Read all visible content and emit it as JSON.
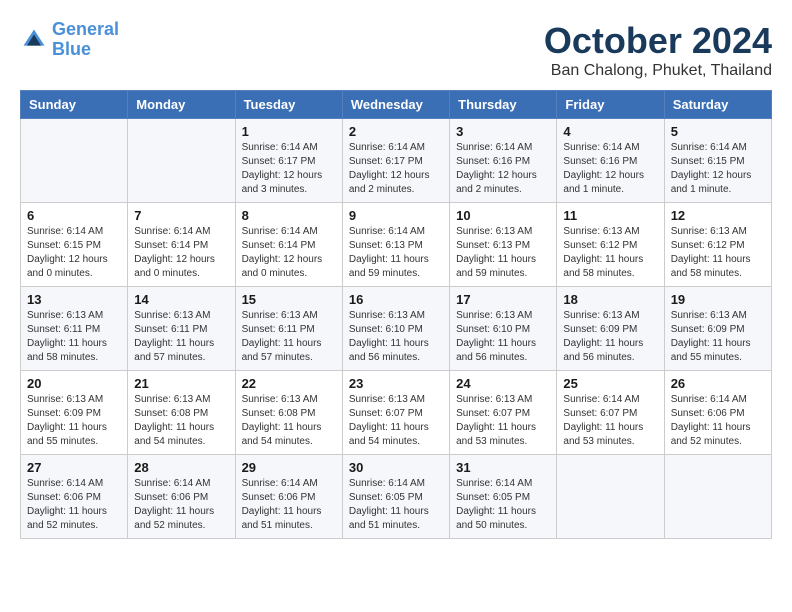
{
  "logo": {
    "line1": "General",
    "line2": "Blue"
  },
  "title": "October 2024",
  "location": "Ban Chalong, Phuket, Thailand",
  "headers": [
    "Sunday",
    "Monday",
    "Tuesday",
    "Wednesday",
    "Thursday",
    "Friday",
    "Saturday"
  ],
  "weeks": [
    [
      {
        "day": "",
        "info": ""
      },
      {
        "day": "",
        "info": ""
      },
      {
        "day": "1",
        "info": "Sunrise: 6:14 AM\nSunset: 6:17 PM\nDaylight: 12 hours\nand 3 minutes."
      },
      {
        "day": "2",
        "info": "Sunrise: 6:14 AM\nSunset: 6:17 PM\nDaylight: 12 hours\nand 2 minutes."
      },
      {
        "day": "3",
        "info": "Sunrise: 6:14 AM\nSunset: 6:16 PM\nDaylight: 12 hours\nand 2 minutes."
      },
      {
        "day": "4",
        "info": "Sunrise: 6:14 AM\nSunset: 6:16 PM\nDaylight: 12 hours\nand 1 minute."
      },
      {
        "day": "5",
        "info": "Sunrise: 6:14 AM\nSunset: 6:15 PM\nDaylight: 12 hours\nand 1 minute."
      }
    ],
    [
      {
        "day": "6",
        "info": "Sunrise: 6:14 AM\nSunset: 6:15 PM\nDaylight: 12 hours\nand 0 minutes."
      },
      {
        "day": "7",
        "info": "Sunrise: 6:14 AM\nSunset: 6:14 PM\nDaylight: 12 hours\nand 0 minutes."
      },
      {
        "day": "8",
        "info": "Sunrise: 6:14 AM\nSunset: 6:14 PM\nDaylight: 12 hours\nand 0 minutes."
      },
      {
        "day": "9",
        "info": "Sunrise: 6:14 AM\nSunset: 6:13 PM\nDaylight: 11 hours\nand 59 minutes."
      },
      {
        "day": "10",
        "info": "Sunrise: 6:13 AM\nSunset: 6:13 PM\nDaylight: 11 hours\nand 59 minutes."
      },
      {
        "day": "11",
        "info": "Sunrise: 6:13 AM\nSunset: 6:12 PM\nDaylight: 11 hours\nand 58 minutes."
      },
      {
        "day": "12",
        "info": "Sunrise: 6:13 AM\nSunset: 6:12 PM\nDaylight: 11 hours\nand 58 minutes."
      }
    ],
    [
      {
        "day": "13",
        "info": "Sunrise: 6:13 AM\nSunset: 6:11 PM\nDaylight: 11 hours\nand 58 minutes."
      },
      {
        "day": "14",
        "info": "Sunrise: 6:13 AM\nSunset: 6:11 PM\nDaylight: 11 hours\nand 57 minutes."
      },
      {
        "day": "15",
        "info": "Sunrise: 6:13 AM\nSunset: 6:11 PM\nDaylight: 11 hours\nand 57 minutes."
      },
      {
        "day": "16",
        "info": "Sunrise: 6:13 AM\nSunset: 6:10 PM\nDaylight: 11 hours\nand 56 minutes."
      },
      {
        "day": "17",
        "info": "Sunrise: 6:13 AM\nSunset: 6:10 PM\nDaylight: 11 hours\nand 56 minutes."
      },
      {
        "day": "18",
        "info": "Sunrise: 6:13 AM\nSunset: 6:09 PM\nDaylight: 11 hours\nand 56 minutes."
      },
      {
        "day": "19",
        "info": "Sunrise: 6:13 AM\nSunset: 6:09 PM\nDaylight: 11 hours\nand 55 minutes."
      }
    ],
    [
      {
        "day": "20",
        "info": "Sunrise: 6:13 AM\nSunset: 6:09 PM\nDaylight: 11 hours\nand 55 minutes."
      },
      {
        "day": "21",
        "info": "Sunrise: 6:13 AM\nSunset: 6:08 PM\nDaylight: 11 hours\nand 54 minutes."
      },
      {
        "day": "22",
        "info": "Sunrise: 6:13 AM\nSunset: 6:08 PM\nDaylight: 11 hours\nand 54 minutes."
      },
      {
        "day": "23",
        "info": "Sunrise: 6:13 AM\nSunset: 6:07 PM\nDaylight: 11 hours\nand 54 minutes."
      },
      {
        "day": "24",
        "info": "Sunrise: 6:13 AM\nSunset: 6:07 PM\nDaylight: 11 hours\nand 53 minutes."
      },
      {
        "day": "25",
        "info": "Sunrise: 6:14 AM\nSunset: 6:07 PM\nDaylight: 11 hours\nand 53 minutes."
      },
      {
        "day": "26",
        "info": "Sunrise: 6:14 AM\nSunset: 6:06 PM\nDaylight: 11 hours\nand 52 minutes."
      }
    ],
    [
      {
        "day": "27",
        "info": "Sunrise: 6:14 AM\nSunset: 6:06 PM\nDaylight: 11 hours\nand 52 minutes."
      },
      {
        "day": "28",
        "info": "Sunrise: 6:14 AM\nSunset: 6:06 PM\nDaylight: 11 hours\nand 52 minutes."
      },
      {
        "day": "29",
        "info": "Sunrise: 6:14 AM\nSunset: 6:06 PM\nDaylight: 11 hours\nand 51 minutes."
      },
      {
        "day": "30",
        "info": "Sunrise: 6:14 AM\nSunset: 6:05 PM\nDaylight: 11 hours\nand 51 minutes."
      },
      {
        "day": "31",
        "info": "Sunrise: 6:14 AM\nSunset: 6:05 PM\nDaylight: 11 hours\nand 50 minutes."
      },
      {
        "day": "",
        "info": ""
      },
      {
        "day": "",
        "info": ""
      }
    ]
  ]
}
